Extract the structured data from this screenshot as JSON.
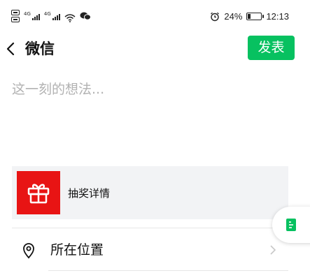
{
  "status_bar": {
    "battery_text": "24%",
    "time": "12:13",
    "battery_level": 0.24,
    "signal_labels": [
      "4G",
      "4G"
    ]
  },
  "header": {
    "title": "微信",
    "publish_label": "发表",
    "publish_color": "#07c160"
  },
  "editor": {
    "placeholder": "这一刻的想法..."
  },
  "card": {
    "title": "抽奖详情",
    "icon": "gift-icon",
    "thumb_color": "#e81414"
  },
  "location": {
    "label": "所在位置",
    "icon": "location-pin-icon"
  },
  "floating": {
    "icon": "document-icon",
    "icon_color": "#07c160"
  }
}
